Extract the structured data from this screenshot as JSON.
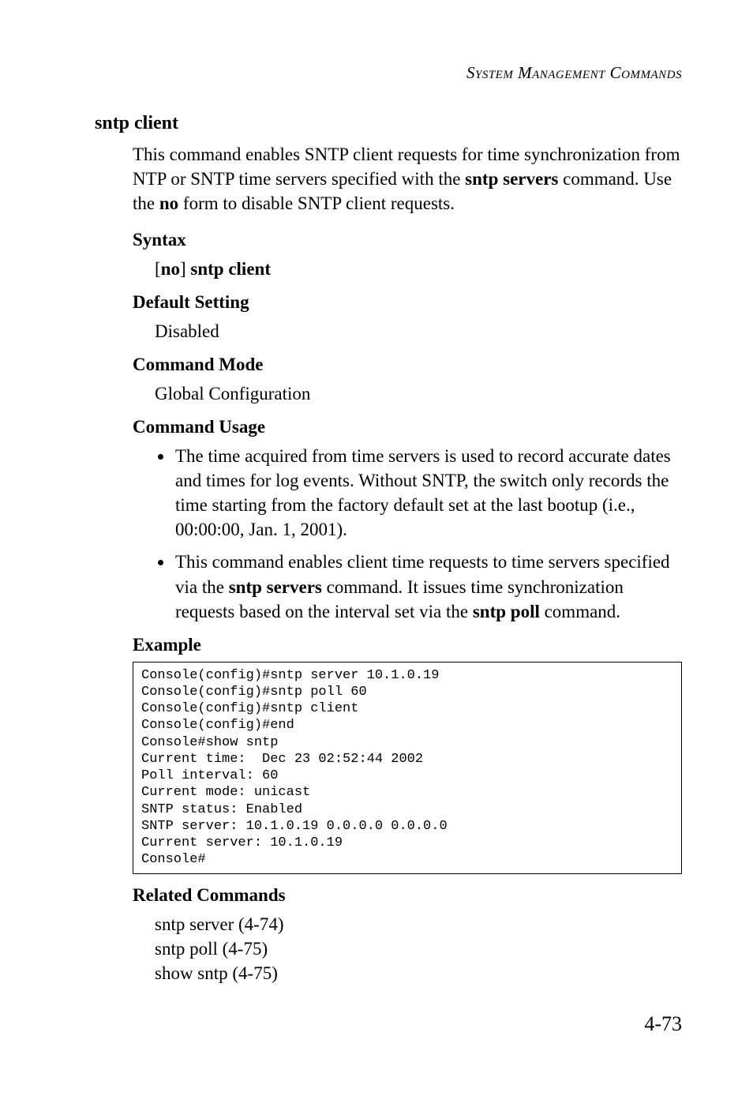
{
  "running_head": "System Management Commands",
  "title": "sntp client",
  "intro_html": "This command enables SNTP client requests for time synchronization from NTP or SNTP time servers specified with the <b>sntp servers</b> command. Use the <b>no</b> form to disable SNTP client requests.",
  "syntax": {
    "heading": "Syntax",
    "line_html": "[<b>no</b>] <b>sntp client</b>"
  },
  "default_setting": {
    "heading": "Default Setting",
    "value": "Disabled"
  },
  "command_mode": {
    "heading": "Command Mode",
    "value": "Global Configuration"
  },
  "command_usage": {
    "heading": "Command Usage",
    "items_html": [
      "The time acquired from time servers is used to record accurate dates and times for log events. Without SNTP, the switch only records the time starting from the factory default set at the last bootup (i.e., 00:00:00, Jan. 1, 2001).",
      "This command enables client time requests to time servers specified via the <b>sntp servers</b> command. It issues time synchronization requests based on the interval set via the <b>sntp poll</b> command."
    ]
  },
  "example": {
    "heading": "Example",
    "code": "Console(config)#sntp server 10.1.0.19\nConsole(config)#sntp poll 60\nConsole(config)#sntp client\nConsole(config)#end\nConsole#show sntp\nCurrent time:  Dec 23 02:52:44 2002\nPoll interval: 60\nCurrent mode: unicast\nSNTP status: Enabled\nSNTP server: 10.1.0.19 0.0.0.0 0.0.0.0\nCurrent server: 10.1.0.19\nConsole#"
  },
  "related": {
    "heading": "Related Commands",
    "lines": [
      "sntp server (4-74)",
      "sntp poll (4-75)",
      "show sntp (4-75)"
    ]
  },
  "page_number": "4-73"
}
